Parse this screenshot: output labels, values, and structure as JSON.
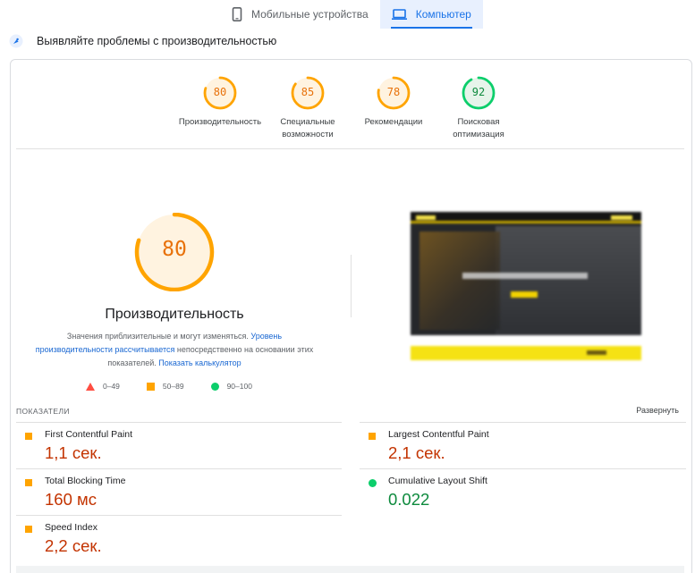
{
  "tabs": [
    {
      "label": "Мобильные устройства",
      "icon": "phone-icon",
      "active": false
    },
    {
      "label": "Компьютер",
      "icon": "laptop-icon",
      "active": true
    }
  ],
  "heading": {
    "text": "Выявляйте проблемы с производительностью",
    "icon": "lighthouse-icon"
  },
  "categories": [
    {
      "score": "80",
      "value": 80,
      "label": "Производительность",
      "color": "#e8710a"
    },
    {
      "score": "85",
      "value": 85,
      "label": "Специальные возможности",
      "color": "#e8710a"
    },
    {
      "score": "78",
      "value": 78,
      "label": "Рекомендации",
      "color": "#e8710a"
    },
    {
      "score": "92",
      "value": 92,
      "label": "Поисковая оптимизация",
      "color": "#0cce6b"
    }
  ],
  "performance": {
    "score": "80",
    "value": 80,
    "title": "Производительность",
    "desc_prefix": "Значения приблизительные и могут изменяться. ",
    "desc_link1": "Уровень производительности рассчитывается",
    "desc_middle": " непосредственно на основании этих показателей. ",
    "desc_link2": "Показать калькулятор"
  },
  "legend": [
    {
      "range": "0–49",
      "shape": "triangle",
      "color": "#ff4e42"
    },
    {
      "range": "50–89",
      "shape": "square",
      "color": "#ffa400"
    },
    {
      "range": "90–100",
      "shape": "circle",
      "color": "#0cce6b"
    }
  ],
  "metrics_header": "ПОКАЗАТЕЛИ",
  "expand_label": "Развернуть",
  "metrics": [
    {
      "name": "First Contentful Paint",
      "value": "1,1 сек.",
      "status": "average"
    },
    {
      "name": "Largest Contentful Paint",
      "value": "2,1 сек.",
      "status": "average"
    },
    {
      "name": "Total Blocking Time",
      "value": "160 мс",
      "status": "average"
    },
    {
      "name": "Cumulative Layout Shift",
      "value": "0.022",
      "status": "good"
    },
    {
      "name": "Speed Index",
      "value": "2,2 сек.",
      "status": "average"
    }
  ],
  "colors": {
    "accent": "#1a73e8",
    "average": "#ffa400",
    "good": "#0cce6b",
    "poor": "#ff4e42"
  }
}
